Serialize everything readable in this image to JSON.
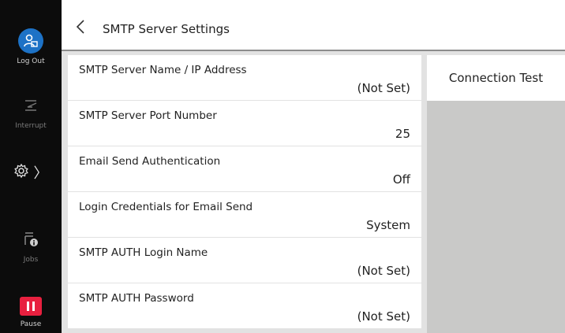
{
  "header": {
    "title": "SMTP Server Settings"
  },
  "sidebar": {
    "logout_label": "Log Out",
    "interrupt_label": "Interrupt",
    "settings_chevron": "〉",
    "jobs_label": "Jobs",
    "pause_label": "Pause"
  },
  "settings": [
    {
      "label": "SMTP Server Name / IP Address",
      "value": "(Not Set)"
    },
    {
      "label": "SMTP Server Port Number",
      "value": "25"
    },
    {
      "label": "Email Send Authentication",
      "value": "Off"
    },
    {
      "label": "Login Credentials for Email Send",
      "value": "System"
    },
    {
      "label": "SMTP AUTH Login Name",
      "value": "(Not Set)"
    },
    {
      "label": "SMTP AUTH Password",
      "value": "(Not Set)"
    }
  ],
  "right_panel": {
    "connection_test_label": "Connection Test"
  },
  "colors": {
    "logout_blue": "#1d72c6",
    "pause_red": "#e8203f",
    "sidebar_bg": "#0c0c0c"
  },
  "icons": [
    "logout-icon",
    "interrupt-icon",
    "gear-icon",
    "jobs-icon",
    "pause-icon",
    "back-arrow-icon"
  ]
}
